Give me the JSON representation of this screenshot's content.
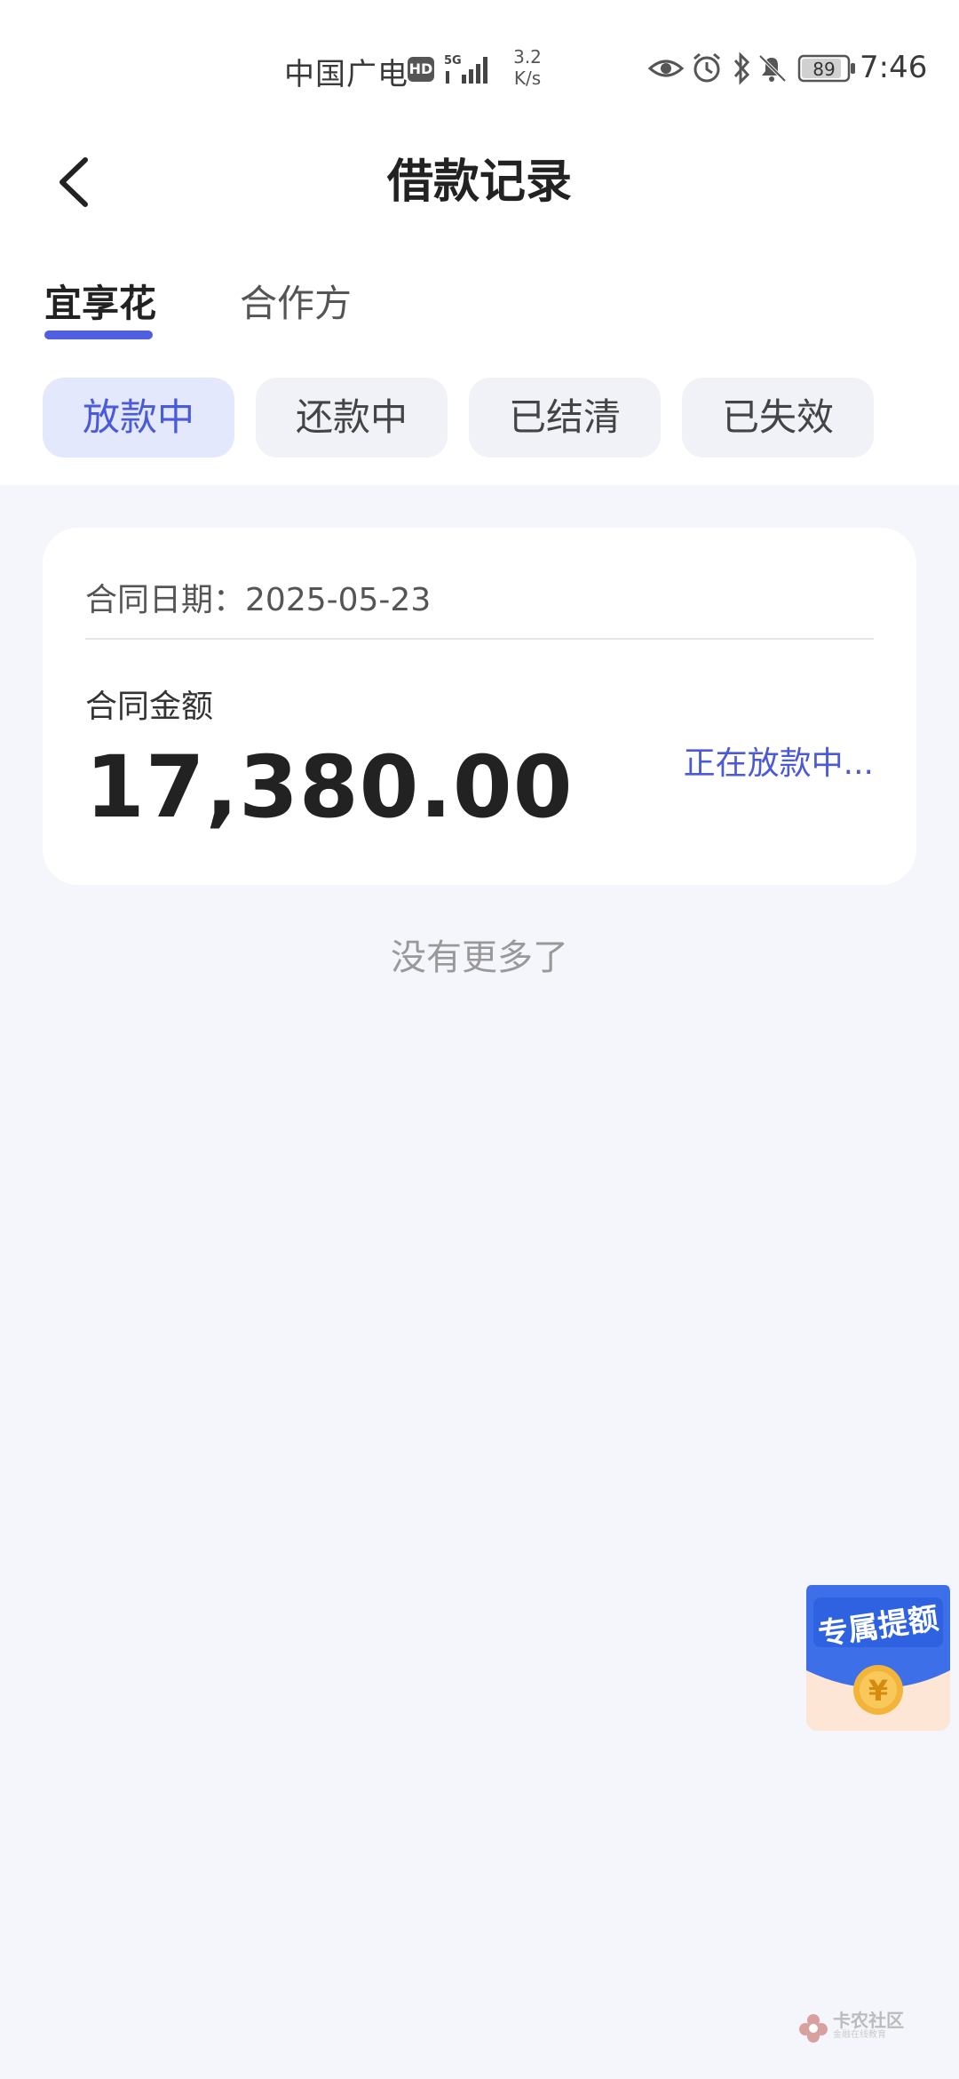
{
  "status_bar": {
    "carrier": "中国广电",
    "hd_badge": "HD",
    "network": "5G",
    "speed_value": "3.2",
    "speed_unit": "K/s",
    "battery": "89",
    "time": "7:46"
  },
  "header": {
    "title": "借款记录"
  },
  "tabs": [
    {
      "label": "宜享花",
      "active": true
    },
    {
      "label": "合作方",
      "active": false
    }
  ],
  "filters": [
    {
      "label": "放款中",
      "active": true
    },
    {
      "label": "还款中",
      "active": false
    },
    {
      "label": "已结清",
      "active": false
    },
    {
      "label": "已失效",
      "active": false
    }
  ],
  "record": {
    "date_label": "合同日期：",
    "date": "2025-05-23",
    "amount_label": "合同金额",
    "amount": "17,380.00",
    "status": "正在放款中..."
  },
  "list_end_text": "没有更多了",
  "promo": {
    "label": "专属提额",
    "coin_symbol": "¥"
  },
  "watermark": {
    "name": "卡农社区",
    "sub": "金融在线教育"
  },
  "colors": {
    "accent": "#4f5fe0",
    "accent_text": "#4a5ad8",
    "chip_active_bg": "#e3e8fd",
    "page_bg": "#f5f6fb"
  }
}
